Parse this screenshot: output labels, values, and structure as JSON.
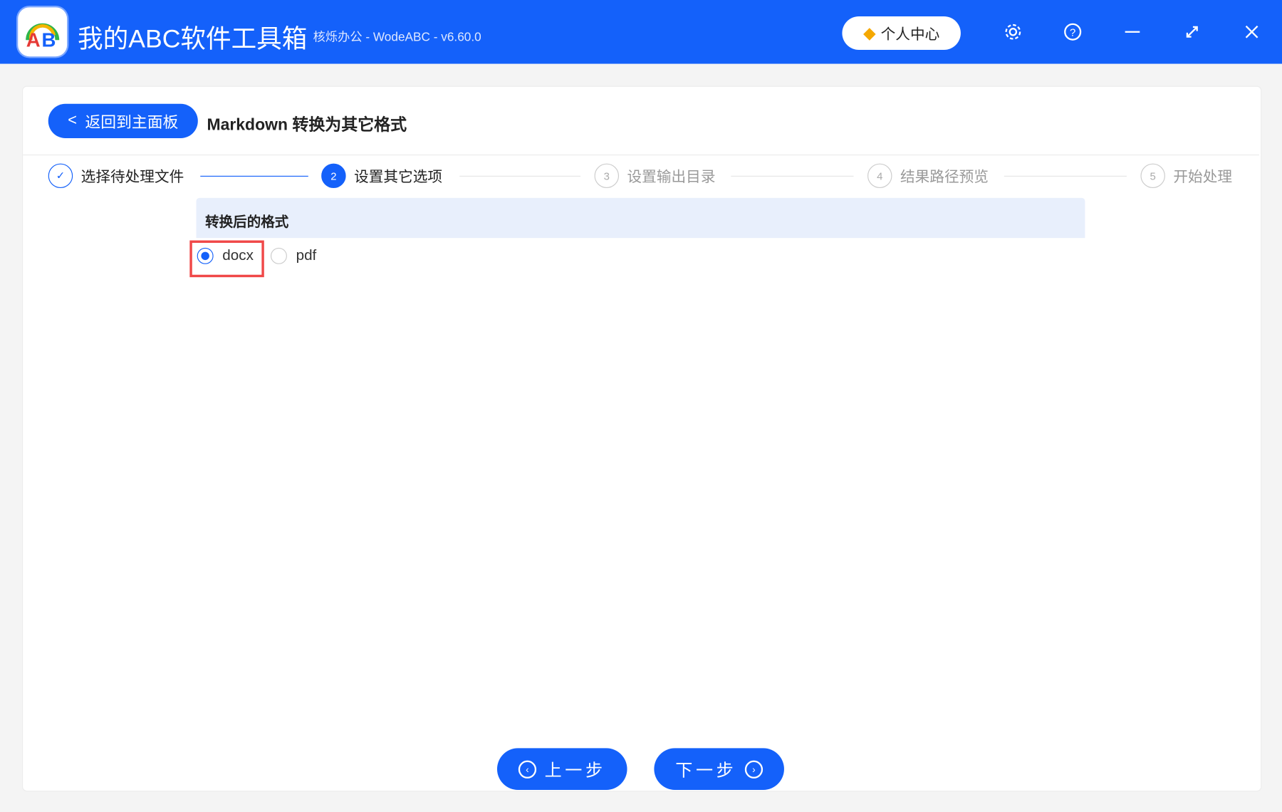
{
  "app": {
    "title": "我的ABC软件工具箱",
    "subtitle": "核烁办公 - WodeABC - v6.60.0",
    "vip_label": "个人中心"
  },
  "header": {
    "back_label": "返回到主面板",
    "page_title": "Markdown 转换为其它格式"
  },
  "steps": [
    {
      "num": "1",
      "label": "选择待处理文件",
      "state": "done"
    },
    {
      "num": "2",
      "label": "设置其它选项",
      "state": "active"
    },
    {
      "num": "3",
      "label": "设置输出目录",
      "state": "pending"
    },
    {
      "num": "4",
      "label": "结果路径预览",
      "state": "pending"
    },
    {
      "num": "5",
      "label": "开始处理",
      "state": "pending"
    }
  ],
  "section": {
    "title": "转换后的格式",
    "options": [
      "docx",
      "pdf"
    ],
    "selected": "docx"
  },
  "footer": {
    "prev_label": "上一步",
    "next_label": "下一步"
  },
  "colors": {
    "primary": "#1461fa",
    "highlight": "#f04848"
  }
}
